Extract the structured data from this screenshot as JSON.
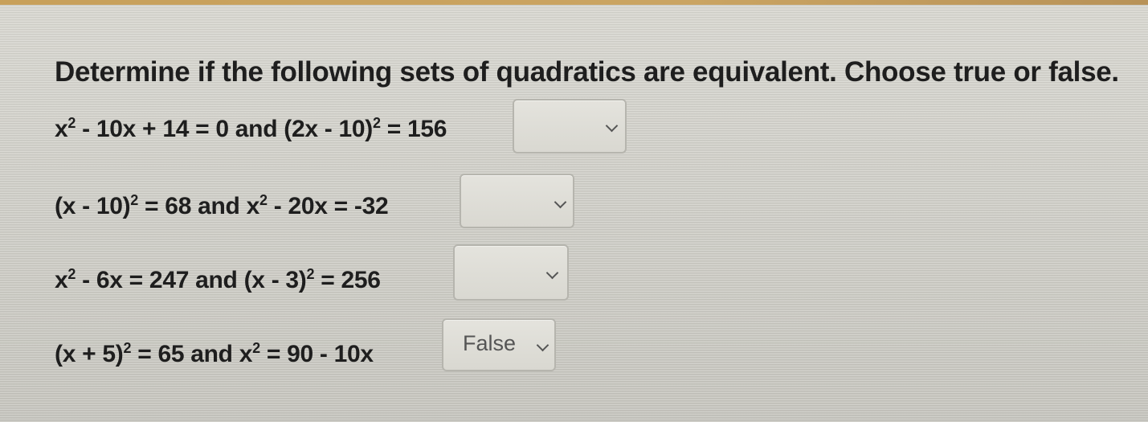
{
  "instruction": "Determine if the following sets of quadratics are equivalent. Choose true or false.",
  "rows": [
    {
      "eq_a": {
        "pre": "x",
        "sup1": "2",
        "post": " - 10x + 14 = 0 and (2x - 10)",
        "sup2": "2",
        "tail": " = 156"
      },
      "selected": ""
    },
    {
      "eq_a": {
        "pre": "(x - 10)",
        "sup1": "2",
        "post": " = 68 and x",
        "sup2": "2",
        "tail": " - 20x = -32"
      },
      "selected": ""
    },
    {
      "eq_a": {
        "pre": "x",
        "sup1": "2",
        "post": " - 6x = 247 and (x - 3)",
        "sup2": "2",
        "tail": " = 256"
      },
      "selected": ""
    },
    {
      "eq_a": {
        "pre": "(x + 5)",
        "sup1": "2",
        "post": " = 65 and x",
        "sup2": "2",
        "tail": " = 90 - 10x"
      },
      "selected": "False"
    }
  ]
}
